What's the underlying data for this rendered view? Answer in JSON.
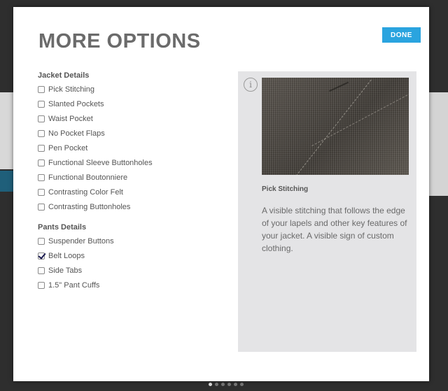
{
  "modal": {
    "title": "MORE OPTIONS",
    "done_label": "DONE"
  },
  "jacket": {
    "heading": "Jacket Details",
    "options": [
      {
        "label": "Pick Stitching",
        "checked": false
      },
      {
        "label": "Slanted Pockets",
        "checked": false
      },
      {
        "label": "Waist Pocket",
        "checked": false
      },
      {
        "label": "No Pocket Flaps",
        "checked": false
      },
      {
        "label": "Pen Pocket",
        "checked": false
      },
      {
        "label": "Functional Sleeve Buttonholes",
        "checked": false
      },
      {
        "label": "Functional Boutonniere",
        "checked": false
      },
      {
        "label": "Contrasting Color Felt",
        "checked": false
      },
      {
        "label": "Contrasting Buttonholes",
        "checked": false
      }
    ]
  },
  "pants": {
    "heading": "Pants Details",
    "options": [
      {
        "label": "Suspender Buttons",
        "checked": false
      },
      {
        "label": "Belt Loops",
        "checked": true
      },
      {
        "label": "Side Tabs",
        "checked": false
      },
      {
        "label": "1.5\" Pant Cuffs",
        "checked": false
      }
    ]
  },
  "info": {
    "icon": "info-icon",
    "title": "Pick Stitching",
    "description": "A visible stitching that follows the edge of your lapels and other key features of your jacket. A visible sign of custom clothing."
  },
  "colors": {
    "accent": "#2aa4df",
    "panel": "#e4e4e6"
  }
}
